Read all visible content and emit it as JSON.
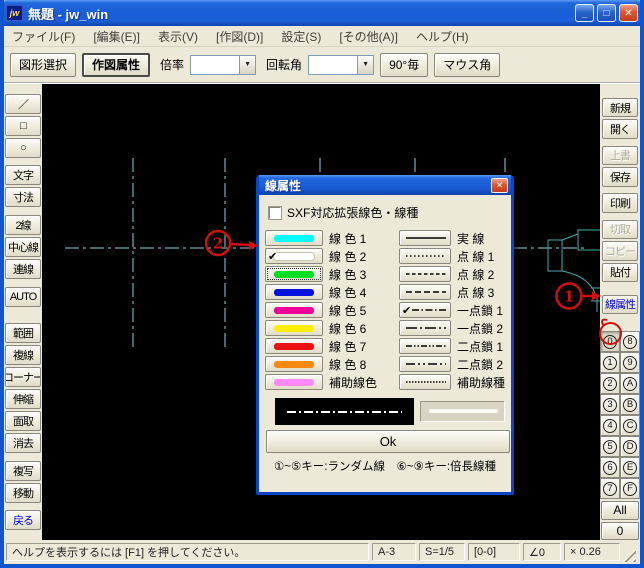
{
  "window": {
    "title": "無題 - jw_win",
    "icon": "jw",
    "controls": {
      "minimize": "_",
      "maximize": "□",
      "close": "✕"
    }
  },
  "menu_bar": {
    "items": [
      "ファイル(F)",
      "[編集(E)]",
      "表示(V)",
      "[作図(D)]",
      "設定(S)",
      "[その他(A)]",
      "ヘルプ(H)"
    ]
  },
  "toolbar": {
    "shape_select": "図形選択",
    "draw_attr": "作図属性",
    "scale_label": "倍率",
    "scale_value": "",
    "rotation_label": "回転角",
    "rotation_value": "",
    "per90": "90°毎",
    "mouse_angle": "マウス角"
  },
  "left_toolbar": {
    "groups": [
      [
        {
          "label": "／"
        },
        {
          "label": "□"
        },
        {
          "label": "○"
        }
      ],
      [
        {
          "label": "文字"
        },
        {
          "label": "寸法"
        }
      ],
      [
        {
          "label": "2線"
        },
        {
          "label": "中心線"
        },
        {
          "label": "連線"
        }
      ],
      [
        {
          "label": "AUTO"
        }
      ],
      [
        {
          "label": "範囲"
        },
        {
          "label": "複線"
        },
        {
          "label": "コーナー"
        },
        {
          "label": "伸縮"
        },
        {
          "label": "面取"
        },
        {
          "label": "消去"
        }
      ],
      [
        {
          "label": "複写"
        },
        {
          "label": "移動"
        }
      ],
      [
        {
          "label": "戻る",
          "accent": true
        }
      ]
    ]
  },
  "right_toolbar": {
    "groups": [
      [
        {
          "label": "新規"
        },
        {
          "label": "開く"
        }
      ],
      [
        {
          "label": "上書",
          "disabled": true
        },
        {
          "label": "保存"
        }
      ],
      [
        {
          "label": "印刷"
        }
      ],
      [
        {
          "label": "切取",
          "disabled": true
        },
        {
          "label": "コピー",
          "disabled": true
        },
        {
          "label": "貼付"
        }
      ],
      [
        {
          "label": "線属性",
          "accent": true
        }
      ]
    ],
    "layer_keys": {
      "left": [
        "0",
        "1",
        "2",
        "3",
        "4",
        "5",
        "6",
        "7"
      ],
      "right": [
        "8",
        "9",
        "A",
        "B",
        "C",
        "D",
        "E",
        "F"
      ],
      "selected": "0"
    },
    "all_button": "All",
    "group_button": "0"
  },
  "dialog": {
    "title": "線属性",
    "close": "✕",
    "sxf_checkbox": {
      "label": "SXF対応拡張線色・線種",
      "checked": false
    },
    "colors": [
      {
        "label": "線 色 1",
        "color": "#00ffff"
      },
      {
        "label": "線 色 2",
        "color": "#ffffff",
        "checked": true
      },
      {
        "label": "線 色 3",
        "color": "#00dd22",
        "focused": true
      },
      {
        "label": "線 色 4",
        "color": "#0011dd"
      },
      {
        "label": "線 色 5",
        "color": "#ee0099"
      },
      {
        "label": "線 色 6",
        "color": "#ffee00"
      },
      {
        "label": "線 色 7",
        "color": "#ee1111"
      },
      {
        "label": "線 色 8",
        "color": "#ff8811"
      },
      {
        "label": "補助線色",
        "color": "#ff88ff"
      }
    ],
    "linetypes": [
      {
        "label": "実 線",
        "dash": ""
      },
      {
        "label": "点 線 1",
        "dash": "1.5 2.5"
      },
      {
        "label": "点 線 2",
        "dash": "3.5 2.5"
      },
      {
        "label": "点 線 3",
        "dash": "6 3"
      },
      {
        "label": "一点鎖 1",
        "dash": "7 2.5 1.5 2.5",
        "checked": true
      },
      {
        "label": "一点鎖 2",
        "dash": "11 3 2 3"
      },
      {
        "label": "二点鎖 1",
        "dash": "6 2 1.5 2 1.5 2"
      },
      {
        "label": "二点鎖 2",
        "dash": "9 3 2 3 2 3"
      },
      {
        "label": "補助線種",
        "dash": "1.5 1.5"
      }
    ],
    "preview_dash": "9 3 2 3",
    "ok": "Ok",
    "caption": "①~⑤キー:ランダム線　⑥~⑨キー:倍長線種"
  },
  "status_bar": {
    "help": "ヘルプを表示するには [F1] を押してください。",
    "panels": [
      "A-3",
      "S=1/5",
      "[0-0]",
      "∠0",
      "× 0.26"
    ]
  },
  "annotations": {
    "step1": "1",
    "step2": "2",
    "color": "#d01010"
  },
  "theme": {
    "chrome": "#ece9d8",
    "canvas_bg": "#000000",
    "centerline": "#8fd4d4",
    "shape_line": "#4aacac",
    "accent_text": "#0000cc"
  }
}
